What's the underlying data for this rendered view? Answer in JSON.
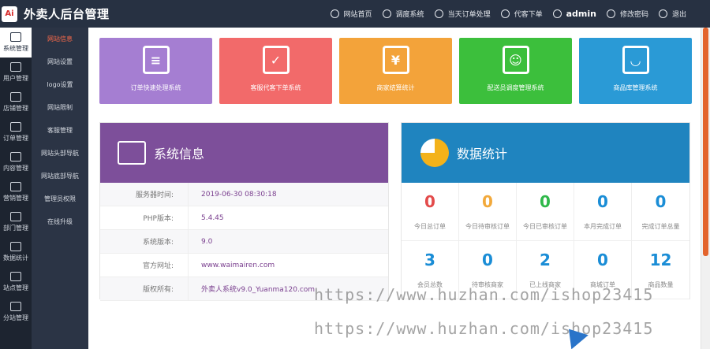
{
  "header": {
    "logo_text": "Ai",
    "title": "外卖人后台管理",
    "nav": [
      {
        "label": "网站首页",
        "icon": "home-icon"
      },
      {
        "label": "调度系统",
        "icon": "dispatch-icon"
      },
      {
        "label": "当天订单处理",
        "icon": "order-icon"
      },
      {
        "label": "代客下单",
        "icon": "proxy-order-icon"
      },
      {
        "label": "admin",
        "icon": "user-icon"
      },
      {
        "label": "修改密码",
        "icon": "password-icon"
      },
      {
        "label": "退出",
        "icon": "power-icon"
      }
    ]
  },
  "sidebar": {
    "items": [
      {
        "label": "系统管理",
        "active": true
      },
      {
        "label": "用户管理"
      },
      {
        "label": "店铺管理"
      },
      {
        "label": "订单管理"
      },
      {
        "label": "内容管理"
      },
      {
        "label": "营销管理"
      },
      {
        "label": "部门管理"
      },
      {
        "label": "数据统计"
      },
      {
        "label": "站点管理"
      },
      {
        "label": "分站管理"
      }
    ]
  },
  "subnav": {
    "items": [
      {
        "label": "网站信息",
        "active": true
      },
      {
        "label": "网站设置"
      },
      {
        "label": "logo设置"
      },
      {
        "label": "网站限制"
      },
      {
        "label": "客服管理"
      },
      {
        "label": "网站头部导航"
      },
      {
        "label": "网站底部导航"
      },
      {
        "label": "管理员权限"
      },
      {
        "label": "在线升级"
      }
    ]
  },
  "tiles": [
    {
      "label": "订单快速处理系统",
      "color": "#a57ed2",
      "icon": "list-icon",
      "glyph": "≡"
    },
    {
      "label": "客服代客下单系统",
      "color": "#f26a6a",
      "icon": "check-icon",
      "glyph": "✓"
    },
    {
      "label": "商家结算统计",
      "color": "#f3a33a",
      "icon": "yen-icon",
      "glyph": "¥"
    },
    {
      "label": "配送员调度管理系统",
      "color": "#3cbf3c",
      "icon": "courier-icon",
      "glyph": "☺"
    },
    {
      "label": "商品库管理系统",
      "color": "#2a9ad6",
      "icon": "bag-icon",
      "glyph": "◡"
    }
  ],
  "system_info": {
    "title": "系统信息",
    "rows": [
      {
        "label": "服务器时间:",
        "value": "2019-06-30 08:30:18"
      },
      {
        "label": "PHP版本:",
        "value": "5.4.45"
      },
      {
        "label": "系统版本:",
        "value": "9.0"
      },
      {
        "label": "官方网址:",
        "value": "www.waimairen.com"
      },
      {
        "label": "版权所有:",
        "value": "外卖人系统v9.0_Yuanma120.com"
      }
    ]
  },
  "stats_panel": {
    "title": "数据统计",
    "items": [
      {
        "value": "0",
        "label": "今日总订单",
        "color": "#e34b4b"
      },
      {
        "value": "0",
        "label": "今日待审核订单",
        "color": "#f2a93b"
      },
      {
        "value": "0",
        "label": "今日已审核订单",
        "color": "#2fb84a"
      },
      {
        "value": "0",
        "label": "本月完成订单",
        "color": "#1a8dd6"
      },
      {
        "value": "0",
        "label": "完成订单总量",
        "color": "#1a8dd6"
      },
      {
        "value": "3",
        "label": "会员总数",
        "color": "#1a8dd6"
      },
      {
        "value": "0",
        "label": "待审核商家",
        "color": "#1a8dd6"
      },
      {
        "value": "2",
        "label": "已上线商家",
        "color": "#1a8dd6"
      },
      {
        "value": "0",
        "label": "商城订单",
        "color": "#1a8dd6"
      },
      {
        "value": "12",
        "label": "商品数量",
        "color": "#1a8dd6"
      }
    ]
  },
  "watermark": "https://www.huzhan.com/ishop23415"
}
